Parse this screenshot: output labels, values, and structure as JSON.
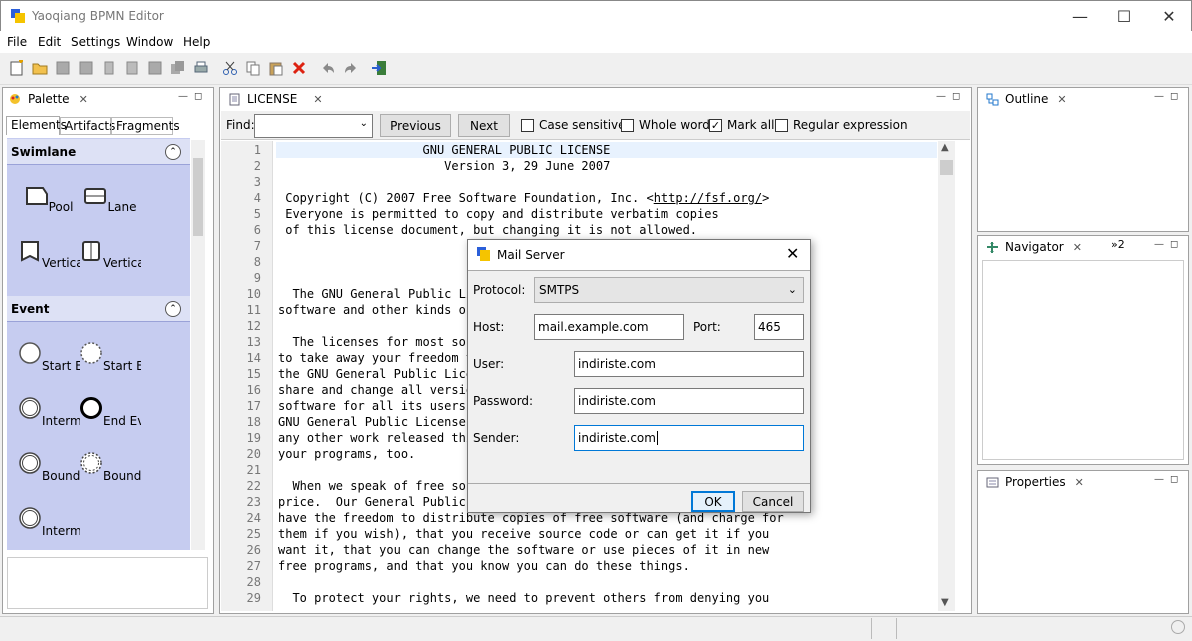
{
  "app": {
    "title": "Yaoqiang BPMN Editor"
  },
  "menu": [
    "File",
    "Edit",
    "Settings",
    "Window",
    "Help"
  ],
  "palette": {
    "tab": "Palette",
    "subtabs": [
      "Elements",
      "Artifacts",
      "Fragments"
    ],
    "drawers": [
      {
        "title": "Swimlane",
        "items": [
          "Pool",
          "Lane",
          "Vertical ...",
          "Vertical L..."
        ]
      },
      {
        "title": "Event",
        "items": [
          "Start Event",
          "Start Ev...",
          "Interme...",
          "End Event",
          "Boundar...",
          "Boundar...",
          "Interme..."
        ]
      }
    ]
  },
  "editor": {
    "tab": "LICENSE",
    "find": {
      "label": "Find:",
      "value": "",
      "previous": "Previous",
      "next": "Next",
      "options": [
        {
          "label": "Case sensitive",
          "checked": false
        },
        {
          "label": "Whole word",
          "checked": false
        },
        {
          "label": "Mark all",
          "checked": true
        },
        {
          "label": "Regular expression",
          "checked": false
        }
      ]
    },
    "lines": [
      "                    GNU GENERAL PUBLIC LICENSE",
      "                       Version 3, 29 June 2007",
      "",
      " Copyright (C) 2007 Free Software Foundation, Inc. <http://fsf.org/>",
      " Everyone is permitted to copy and distribute verbatim copies",
      " of this license document, but changing it is not allowed.",
      "",
      "",
      "",
      "  The GNU General Public Li",
      "software and other kinds of",
      "",
      "  The licenses for most sof",
      "to take away your freedom t",
      "the GNU General Public Lice",
      "share and change all versio",
      "software for all its users.",
      "GNU General Public License",
      "any other work released thi",
      "your programs, too.",
      "",
      "  When we speak of free sof",
      "price.  Our General Public",
      "have the freedom to distribute copies of free software (and charge for",
      "them if you wish), that you receive source code or can get it if you",
      "want it, that you can change the software or use pieces of it in new",
      "free programs, and that you know you can do these things.",
      "",
      "  To protect your rights, we need to prevent others from denying you"
    ]
  },
  "outline": {
    "tab": "Outline"
  },
  "navigator": {
    "tab": "Navigator",
    "overflow": "»2"
  },
  "properties": {
    "tab": "Properties"
  },
  "dialog": {
    "title": "Mail Server",
    "protocol_label": "Protocol:",
    "protocol_value": "SMTPS",
    "host_label": "Host:",
    "host_value": "mail.example.com",
    "port_label": "Port:",
    "port_value": "465",
    "user_label": "User:",
    "user_value": "indiriste.com",
    "password_label": "Password:",
    "password_value": "indiriste.com",
    "sender_label": "Sender:",
    "sender_value": "indiriste.com",
    "ok": "OK",
    "cancel": "Cancel"
  }
}
